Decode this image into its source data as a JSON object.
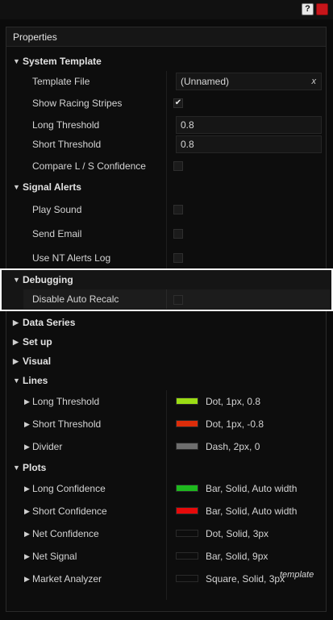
{
  "window": {
    "help_label": "?"
  },
  "panel": {
    "title": "Properties"
  },
  "categories": {
    "system_template": "System Template",
    "signal_alerts": "Signal Alerts",
    "debugging": "Debugging",
    "data_series": "Data Series",
    "set_up": "Set up",
    "visual": "Visual",
    "lines": "Lines",
    "plots": "Plots"
  },
  "system_template": {
    "template_file": {
      "label": "Template File",
      "value": "(Unnamed)",
      "clear": "x"
    },
    "show_racing_stripes": {
      "label": "Show Racing Stripes",
      "checked": true
    },
    "long_threshold": {
      "label": "Long Threshold",
      "value": "0.8"
    },
    "short_threshold": {
      "label": "Short Threshold",
      "value": "0.8"
    },
    "compare_confidence": {
      "label": "Compare L / S Confidence",
      "checked": false
    }
  },
  "signal_alerts": {
    "play_sound": {
      "label": "Play Sound",
      "checked": false
    },
    "send_email": {
      "label": "Send Email",
      "checked": false
    },
    "use_nt_alerts_log": {
      "label": "Use NT Alerts Log",
      "checked": false
    }
  },
  "debugging": {
    "disable_auto_recalc": {
      "label": "Disable Auto Recalc",
      "checked": false
    }
  },
  "lines": [
    {
      "label": "Long Threshold",
      "value": "Dot, 1px, 0.8",
      "color": "#9bdc14"
    },
    {
      "label": "Short Threshold",
      "value": "Dot, 1px, -0.8",
      "color": "#dc2d0a"
    },
    {
      "label": "Divider",
      "value": "Dash, 2px, 0",
      "color": "#6e6e6e"
    }
  ],
  "plots": [
    {
      "label": "Long Confidence",
      "value": "Bar, Solid, Auto width",
      "color": "#1eb91e"
    },
    {
      "label": "Short Confidence",
      "value": "Bar, Solid, Auto width",
      "color": "#e60a0a"
    },
    {
      "label": "Net Confidence",
      "value": "Dot, Solid, 3px",
      "color": "#0d0d0d"
    },
    {
      "label": "Net Signal",
      "value": "Bar, Solid, 9px",
      "color": "#0d0d0d"
    },
    {
      "label": "Market Analyzer",
      "value": "Square, Solid, 3px",
      "color": "#0d0d0d"
    }
  ],
  "footer": {
    "note": "template"
  },
  "icons": {
    "expanded": "chevron-down-icon",
    "collapsed": "chevron-right-icon",
    "check": "checkmark-icon"
  }
}
